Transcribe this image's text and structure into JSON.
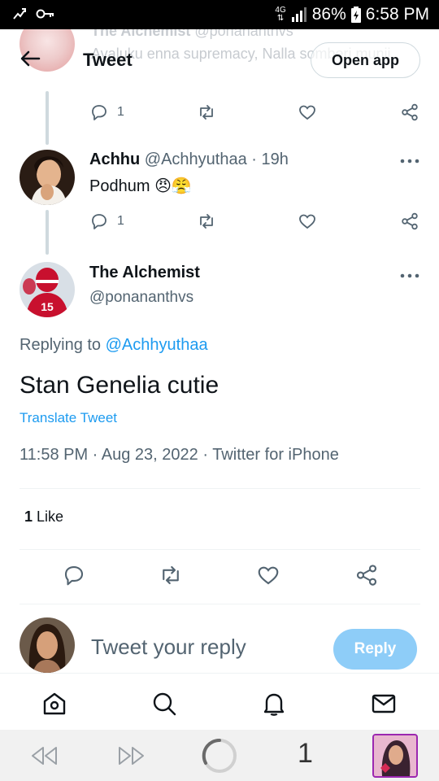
{
  "status_bar": {
    "network": "4G",
    "battery": "86%",
    "time": "6:58 PM"
  },
  "faded_tweet": {
    "name": "The Alchemist",
    "handle": "@ponananthvs",
    "text": "Avaluku enna supremacy, Nalla somberi munji"
  },
  "header": {
    "title": "Tweet",
    "open_app": "Open app"
  },
  "tweet1": {
    "reply_count": "1"
  },
  "tweet2": {
    "name": "Achhu",
    "handle": "@Achhyuthaa",
    "time": "· 19h",
    "text": "Podhum",
    "emojis": "😠😤",
    "reply_count": "1"
  },
  "main_tweet": {
    "name": "The Alchemist",
    "handle": "@ponananthvs",
    "replying_prefix": "Replying to",
    "replying_to": "@Achhyuthaa",
    "text": "Stan Genelia cutie",
    "translate": "Translate Tweet",
    "meta": "11:58 PM · Aug 23, 2022 · Twitter for iPhone",
    "like_count": "1",
    "like_label": "Like"
  },
  "reply": {
    "placeholder": "Tweet your reply",
    "button": "Reply"
  },
  "bottom_nav": {
    "items": [
      "home-icon",
      "search-icon",
      "notifications-icon",
      "messages-icon"
    ]
  },
  "browser": {
    "tab_count": "1"
  },
  "colors": {
    "accent": "#1d9bf0",
    "reply_button": "#8ecdf8",
    "secondary_text": "#536471"
  }
}
